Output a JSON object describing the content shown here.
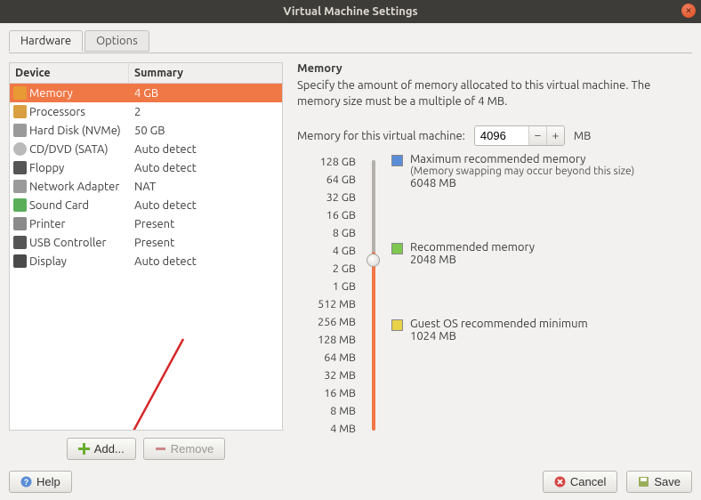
{
  "window": {
    "title": "Virtual Machine Settings"
  },
  "tabs": {
    "hardware": "Hardware",
    "options": "Options"
  },
  "hw_header": {
    "device": "Device",
    "summary": "Summary"
  },
  "devices": [
    {
      "name": "Memory",
      "summary": "4 GB"
    },
    {
      "name": "Processors",
      "summary": "2"
    },
    {
      "name": "Hard Disk (NVMe)",
      "summary": "50 GB"
    },
    {
      "name": "CD/DVD (SATA)",
      "summary": "Auto detect"
    },
    {
      "name": "Floppy",
      "summary": "Auto detect"
    },
    {
      "name": "Network Adapter",
      "summary": "NAT"
    },
    {
      "name": "Sound Card",
      "summary": "Auto detect"
    },
    {
      "name": "Printer",
      "summary": "Present"
    },
    {
      "name": "USB Controller",
      "summary": "Present"
    },
    {
      "name": "Display",
      "summary": "Auto detect"
    }
  ],
  "hw_buttons": {
    "add": "Add...",
    "remove": "Remove"
  },
  "memory": {
    "heading": "Memory",
    "description": "Specify the amount of memory allocated to this virtual machine. The memory size must be a multiple of 4 MB.",
    "label": "Memory for this virtual machine:",
    "value": "4096",
    "unit": "MB",
    "scale": [
      "128 GB",
      "64 GB",
      "32 GB",
      "16 GB",
      "8 GB",
      "4 GB",
      "2 GB",
      "1 GB",
      "512 MB",
      "256 MB",
      "128 MB",
      "64 MB",
      "32 MB",
      "16 MB",
      "8 MB",
      "4 MB"
    ],
    "max_rec": {
      "title": "Maximum recommended memory",
      "note": "(Memory swapping may occur beyond this size)",
      "value": "6048 MB"
    },
    "rec": {
      "title": "Recommended memory",
      "value": "2048 MB"
    },
    "min": {
      "title": "Guest OS recommended minimum",
      "value": "1024 MB"
    }
  },
  "actions": {
    "help": "Help",
    "cancel": "Cancel",
    "save": "Save"
  },
  "icon_colors": {
    "memory": "#e89a34",
    "processors": "#d8a040",
    "harddisk": "#9a9a9a",
    "cddvd": "#bababa",
    "floppy": "#555",
    "network": "#9a9a9a",
    "sound": "#5aae5a",
    "printer": "#8a8a8a",
    "usb": "#555",
    "display": "#4a4a4a"
  }
}
